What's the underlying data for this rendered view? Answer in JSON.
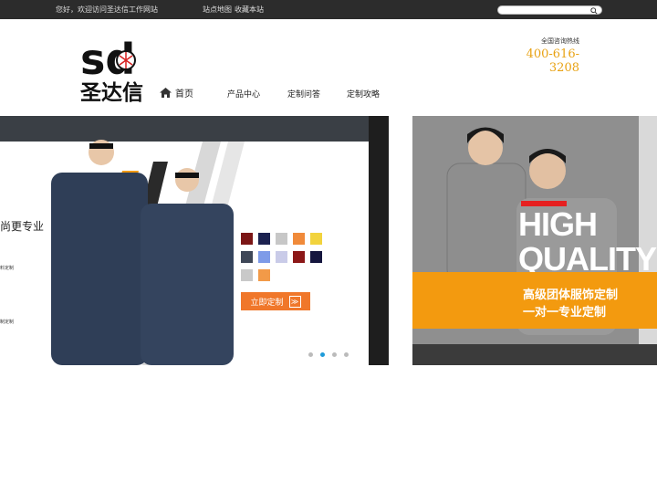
{
  "topbar": {
    "welcome": "您好，欢迎访问圣达信工作网站",
    "links": [
      "站点地图",
      "收藏本站"
    ],
    "search_placeholder": ""
  },
  "logo": {
    "mark": "sd",
    "name": "圣达信"
  },
  "nav": {
    "home": "首页",
    "items": [
      "产品中心",
      "定制问答",
      "定制攻略"
    ]
  },
  "hotline": {
    "label": "全国咨询热线",
    "number": "400-616-3208"
  },
  "banner": {
    "main": {
      "slogan": "尚更专业",
      "notes": [
        "料定制",
        "制定制"
      ],
      "button": "立即定制",
      "button_arrow": "≫",
      "swatches": [
        "#7b1616",
        "#1c2250",
        "#c7c7c7",
        "#f08a3a",
        "#f2d33d",
        "#3f4858",
        "#7e9be8",
        "#c9cbe8",
        "#8c1818",
        "#15163e",
        "#c9c9c9",
        "#f29a48"
      ]
    },
    "side": {
      "hq_line1": "HIGH",
      "hq_line2": "QUALITY",
      "text_line1": "高级团体服饰定制",
      "text_line2": "一对一专业定制"
    },
    "dots": {
      "count": 4,
      "active": 1
    }
  },
  "colors": {
    "accent": "#e8a213",
    "topbar": "#2c2c2c",
    "button": "#f0772a",
    "dot_active": "#1f9bd9"
  }
}
